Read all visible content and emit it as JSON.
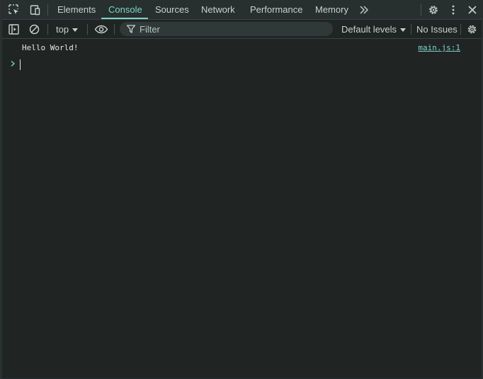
{
  "tabs": [
    {
      "label": "Elements",
      "active": false
    },
    {
      "label": "Console",
      "active": true
    },
    {
      "label": "Sources",
      "active": false
    },
    {
      "label": "Network",
      "active": false
    },
    {
      "label": "Performance",
      "active": false
    },
    {
      "label": "Memory",
      "active": false
    }
  ],
  "toolbar": {
    "context": "top",
    "filter_placeholder": "Filter",
    "levels": "Default levels",
    "issues": "No Issues"
  },
  "console": {
    "messages": [
      {
        "text": "Hello World!",
        "source": "main.js:1"
      }
    ]
  },
  "icons": {
    "inspect": "inspect-element-icon",
    "device": "device-toolbar-icon",
    "more_tabs": "more-tabs-icon",
    "settings": "gear-icon",
    "menu": "kebab-menu-icon",
    "close": "close-icon",
    "sidebar": "sidebar-toggle-icon",
    "clear": "clear-console-icon",
    "live": "eye-icon",
    "filter": "filter-icon",
    "prompt": "chevron-right-icon"
  },
  "colors": {
    "accent": "#7fd3c9",
    "background": "#202524",
    "text": "#c9d1cf"
  }
}
